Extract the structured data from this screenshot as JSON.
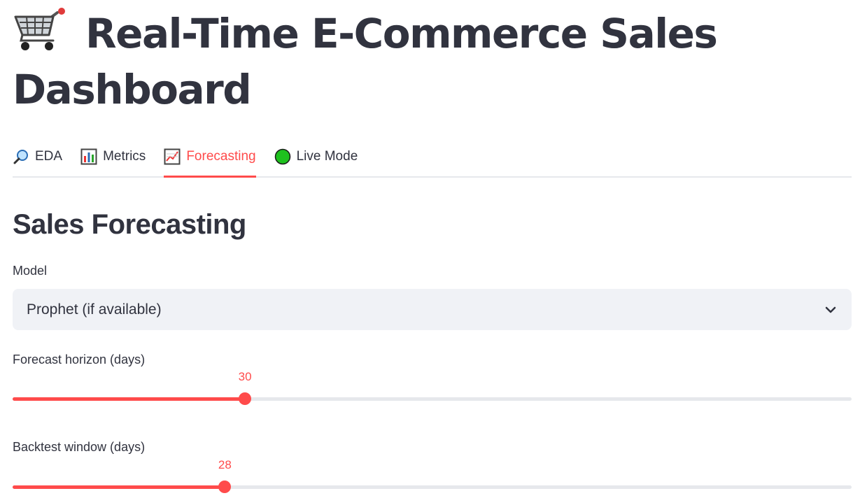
{
  "header": {
    "title": "Real-Time E-Commerce Sales Dashboard",
    "title_icon": "shopping-cart-icon"
  },
  "tabs": [
    {
      "label": "EDA",
      "icon": "magnifying-glass-icon",
      "active": false
    },
    {
      "label": "Metrics",
      "icon": "bar-chart-icon",
      "active": false
    },
    {
      "label": "Forecasting",
      "icon": "line-chart-icon",
      "active": true
    },
    {
      "label": "Live Mode",
      "icon": "green-circle-icon",
      "active": false
    }
  ],
  "main": {
    "section_title": "Sales Forecasting",
    "model": {
      "label": "Model",
      "selected": "Prophet (if available)"
    },
    "horizon": {
      "label": "Forecast horizon (days)",
      "value": "30",
      "fraction": 0.277
    },
    "backtest": {
      "label": "Backtest window (days)",
      "value": "28",
      "fraction": 0.253
    }
  },
  "colors": {
    "accent": "#ff4b4b",
    "text": "#31333f",
    "track": "#e6e8ec",
    "select_bg": "#f0f2f6",
    "live_green": "#1ec11e"
  }
}
